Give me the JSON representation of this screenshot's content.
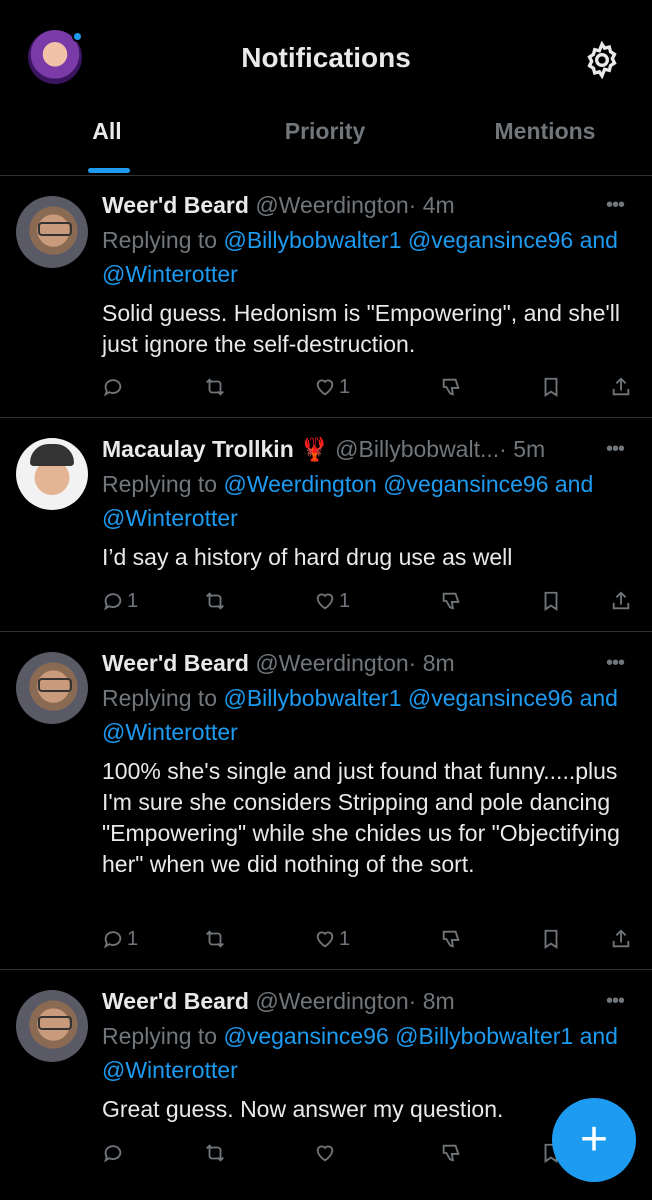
{
  "header": {
    "title": "Notifications",
    "tabs": [
      {
        "label": "All"
      },
      {
        "label": "Priority"
      },
      {
        "label": "Mentions"
      }
    ],
    "icons": {
      "settings": "gear-icon",
      "profile": "avatar"
    },
    "accent": "#1d9bf0"
  },
  "posts": [
    {
      "name": "Weer'd Beard",
      "handle": "@Weerdington",
      "time": "· 4m",
      "replying_prefix": "Replying to",
      "mention1": "@Billybobwalter1",
      "mention2": "@vegansince96",
      "and": "and",
      "mention3": "@Winterotter",
      "text": "Solid guess.   Hedonism is \"Empowering\",  and she'll just ignore the self-destruction.",
      "reply_count": "",
      "like_count": "1"
    },
    {
      "name": "Macaulay Trollkin",
      "emoji": "🦞",
      "handle": "@Billybobwalt...",
      "time": "· 5m",
      "replying_prefix": "Replying to",
      "mention1": "@Weerdington",
      "mention2": "@vegansince96",
      "and": "and",
      "mention3": "@Winterotter",
      "text": "I’d say a history of hard drug use as well",
      "reply_count": "1",
      "like_count": "1"
    },
    {
      "name": "Weer'd Beard",
      "handle": "@Weerdington",
      "time": "· 8m",
      "replying_prefix": "Replying to",
      "mention1": "@Billybobwalter1",
      "mention2": "@vegansince96",
      "and": "and",
      "mention3": "@Winterotter",
      "text": "100% she's single and just found that funny.....plus I'm sure she considers Stripping and pole dancing \"Empowering\"   while she chides us for \"Objectifying her\"  when we did nothing of the sort.",
      "reply_count": "1",
      "like_count": "1"
    },
    {
      "name": "Weer'd Beard",
      "handle": "@Weerdington",
      "time": "· 8m",
      "replying_prefix": "Replying to",
      "mention1": "@vegansince96",
      "mention2": "@Billybobwalter1",
      "and": "and",
      "mention3": "@Winterotter",
      "text": "Great guess.   Now answer my question.",
      "reply_count": "",
      "like_count": ""
    }
  ],
  "more_label": "•••",
  "fab_label": "+"
}
